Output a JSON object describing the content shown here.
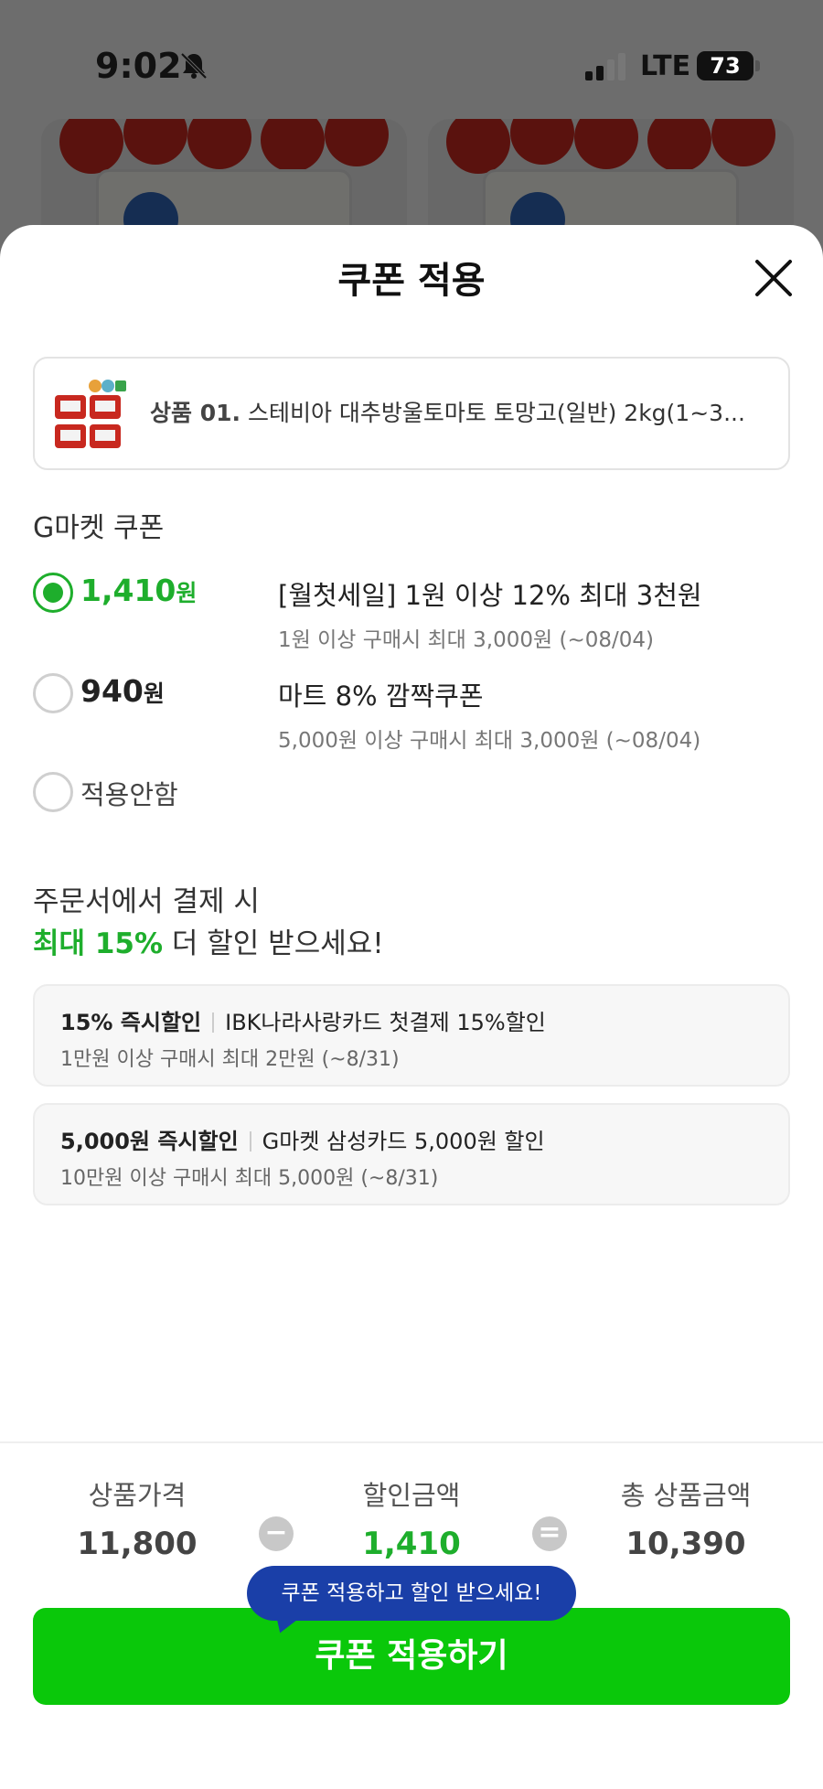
{
  "status_bar": {
    "time": "9:02",
    "network": "LTE",
    "battery": "73",
    "icons": [
      "bell-slash-icon",
      "signal-icon",
      "battery-icon"
    ]
  },
  "sheet": {
    "title": "쿠폰 적용",
    "close_icon": "close-icon"
  },
  "product": {
    "label": "상품 01.",
    "name": "스테비아 대추방울토마토 토망고(일반) 2kg(1~3..."
  },
  "gmarket_coupons": {
    "section_title": "G마켓 쿠폰",
    "unit": "원",
    "options": [
      {
        "amount": "1,410",
        "name": "[월첫세일] 1원 이상 12% 최대 3천원",
        "desc": "1원 이상 구매시 최대 3,000원 (~08/04)",
        "selected": true
      },
      {
        "amount": "940",
        "name": "마트 8% 깜짝쿠폰",
        "desc": "5,000원 이상 구매시 최대 3,000원 (~08/04)",
        "selected": false
      }
    ],
    "none_label": "적용안함"
  },
  "promo": {
    "line1": "주문서에서 결제 시",
    "highlight": "최대 15%",
    "line2_rest": " 더 할인 받으세요!"
  },
  "card_offers": [
    {
      "badge": "15% 즉시할인",
      "title": "IBK나라사랑카드 첫결제 15%할인",
      "desc": "1만원 이상 구매시 최대 2만원 (~8/31)"
    },
    {
      "badge": "5,000원 즉시할인",
      "title": "G마켓 삼성카드 5,000원 할인",
      "desc": "10만원 이상 구매시 최대 5,000원 (~8/31)"
    }
  ],
  "summary": {
    "price_label": "상품가격",
    "price_value": "11,800",
    "minus": "−",
    "discount_label": "할인금액",
    "discount_value": "1,410",
    "equals": "=",
    "total_label": "총 상품금액",
    "total_value": "10,390"
  },
  "tooltip": "쿠폰 적용하고 할인 받으세요!",
  "apply_button": "쿠폰 적용하기",
  "colors": {
    "accent_green": "#1eae2c",
    "button_green": "#0ac80a",
    "tooltip_blue": "#1a3fa8"
  }
}
